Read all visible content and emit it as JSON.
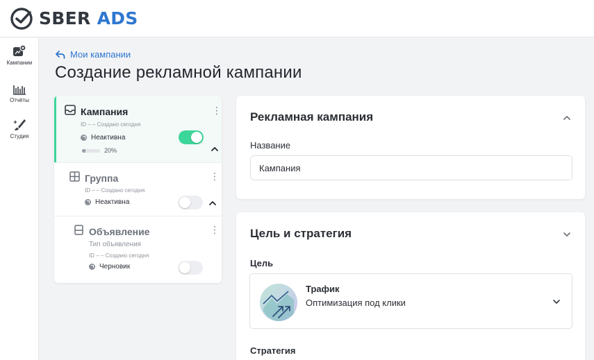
{
  "brand": {
    "sber": "SBER",
    "ads": "ADS",
    "accent": "#2e77d0",
    "logo_icon": "check-circle-icon"
  },
  "sidebar": {
    "items": [
      {
        "label": "Кампании",
        "icon": "campaign-icon"
      },
      {
        "label": "Отчёты",
        "icon": "reports-icon"
      },
      {
        "label": "Студия",
        "icon": "studio-icon"
      }
    ]
  },
  "header": {
    "back_label": "Мои кампании",
    "page_title": "Создание рекламной кампании"
  },
  "tree": {
    "campaign": {
      "title": "Кампания",
      "meta": "ID – –    Создано сегодня",
      "status": "Неактивна",
      "toggle_on": true,
      "progress_label": "20%",
      "progress_value": 0.2
    },
    "group": {
      "title": "Группа",
      "meta": "ID – –    Создано сегодня",
      "status": "Неактивна",
      "toggle_on": false
    },
    "ad": {
      "title": "Объявление",
      "type_label": "Тип объявления",
      "meta": "ID – –    Создано сегодня",
      "status": "Черновик",
      "toggle_on": false
    }
  },
  "campaign_card": {
    "title": "Рекламная кампания",
    "name_label": "Название",
    "name_value": "Кампания"
  },
  "goal_card": {
    "title": "Цель и стратегия",
    "goal_label": "Цель",
    "goal_title": "Трафик",
    "goal_desc": "Оптимизация под клики",
    "strategy_label": "Стратегия"
  },
  "colors": {
    "toggle_on": "#3dd69a",
    "active_border": "#3dd69a",
    "link": "#2e77d0"
  }
}
